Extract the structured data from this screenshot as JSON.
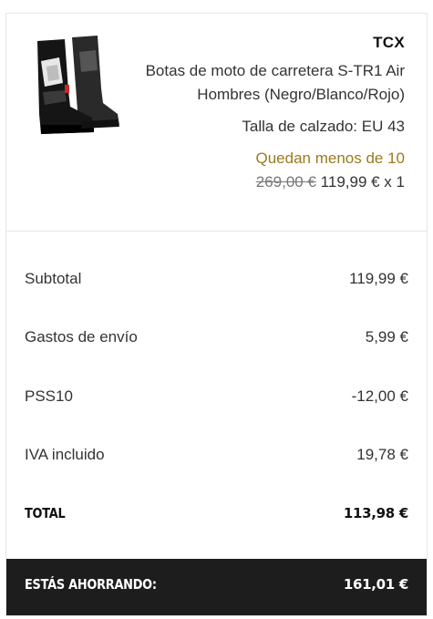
{
  "product": {
    "brand": "TCX",
    "name": "Botas de moto de carretera S-TR1 Air Hombres (Negro/Blanco/Rojo)",
    "size": "Talla de calzado: EU 43",
    "stock": "Quedan menos de 10",
    "old_price": "269,00 €",
    "price": "119,99 € x 1",
    "image": "motorcycle-boots-image"
  },
  "summary": {
    "rows": [
      {
        "label": "Subtotal",
        "value": "119,99 €"
      },
      {
        "label": "Gastos de envío",
        "value": "5,99 €"
      },
      {
        "label": "PSS10",
        "value": "-12,00 €"
      },
      {
        "label": "IVA incluido",
        "value": "19,78 €"
      }
    ],
    "total_label": "TOTAL",
    "total_value": "113,98 €"
  },
  "savings": {
    "label": "ESTÁS AHORRANDO:",
    "value": "161,01 €"
  },
  "colors": {
    "stock_text": "#9b7a1c",
    "savings_bg": "#1d1d1d"
  }
}
